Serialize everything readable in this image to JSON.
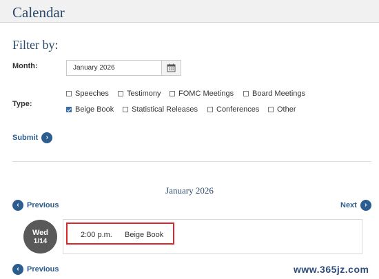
{
  "header": {
    "title": "Calendar"
  },
  "filter": {
    "title": "Filter by:",
    "month_label": "Month:",
    "month_value": "January 2026",
    "type_label": "Type:",
    "types": [
      {
        "label": "Speeches",
        "checked": false
      },
      {
        "label": "Testimony",
        "checked": false
      },
      {
        "label": "FOMC Meetings",
        "checked": false
      },
      {
        "label": "Board Meetings",
        "checked": false
      },
      {
        "label": "Beige Book",
        "checked": true
      },
      {
        "label": "Statistical Releases",
        "checked": false
      },
      {
        "label": "Conferences",
        "checked": false
      },
      {
        "label": "Other",
        "checked": false
      }
    ],
    "submit_label": "Submit"
  },
  "calendar": {
    "month_heading": "January 2026",
    "previous_label": "Previous",
    "next_label": "Next",
    "events": [
      {
        "day": "Wed",
        "date": "1/14",
        "time": "2:00 p.m.",
        "name": "Beige Book"
      }
    ]
  },
  "watermark": "www.365jz.com",
  "icons": {
    "calendar": "calendar-icon",
    "arrow_right": "chevron-right-icon",
    "arrow_left": "chevron-left-icon"
  },
  "colors": {
    "accent": "#2c5d8f",
    "highlight": "#d9262b",
    "day_circle": "#595959"
  }
}
